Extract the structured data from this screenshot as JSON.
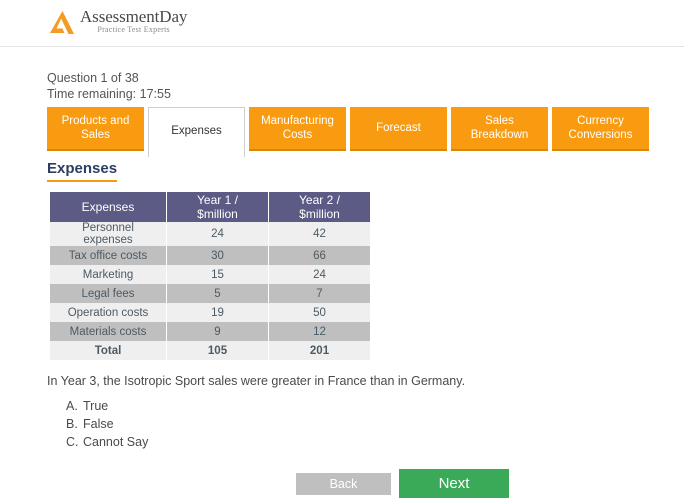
{
  "brand": {
    "logo_icon": "assessmentday-triangle-logo",
    "name": "AssessmentDay",
    "tagline": "Practice Test Experts",
    "accent_orange": "#F99B10",
    "heading_navy": "#2C3E63",
    "table_header_purple": "#5B5B85",
    "next_green": "#3BAA58",
    "back_gray": "#BFBFBF"
  },
  "meta": {
    "question_counter": "Question 1 of 38",
    "time_remaining": "Time remaining: 17:55"
  },
  "tabs": [
    {
      "label": "Products and Sales",
      "active": false
    },
    {
      "label": "Expenses",
      "active": true
    },
    {
      "label": "Manufacturing Costs",
      "active": false
    },
    {
      "label": "Forecast",
      "active": false
    },
    {
      "label": "Sales Breakdown",
      "active": false
    },
    {
      "label": "Currency Conversions",
      "active": false
    }
  ],
  "section": {
    "heading": "Expenses"
  },
  "chart_data": {
    "type": "table",
    "title": "Expenses",
    "columns": [
      "Expenses",
      "Year 1 / $million",
      "Year 2 / $million"
    ],
    "categories": [
      "Personnel expenses",
      "Tax office costs",
      "Marketing",
      "Legal fees",
      "Operation costs",
      "Materials costs",
      "Total"
    ],
    "series": [
      {
        "name": "Year 1 / $million",
        "values": [
          24,
          30,
          15,
          5,
          19,
          9,
          105
        ]
      },
      {
        "name": "Year 2 / $million",
        "values": [
          42,
          66,
          24,
          7,
          50,
          12,
          201
        ]
      }
    ],
    "rows": [
      {
        "label": "Personnel expenses",
        "year1": "24",
        "year2": "42",
        "style": "light"
      },
      {
        "label": "Tax office costs",
        "year1": "30",
        "year2": "66",
        "style": "dark"
      },
      {
        "label": "Marketing",
        "year1": "15",
        "year2": "24",
        "style": "light"
      },
      {
        "label": "Legal fees",
        "year1": "5",
        "year2": "7",
        "style": "dark"
      },
      {
        "label": "Operation costs",
        "year1": "19",
        "year2": "50",
        "style": "light"
      },
      {
        "label": "Materials costs",
        "year1": "9",
        "year2": "12",
        "style": "dark"
      },
      {
        "label": "Total",
        "year1": "105",
        "year2": "201",
        "style": "total"
      }
    ],
    "xlabel": "",
    "ylabel": "$million",
    "grid": false,
    "legend": "none"
  },
  "question": {
    "stem": "In Year 3, the Isotropic Sport sales were greater in France than in Germany.",
    "answers": [
      {
        "letter": "A.",
        "text": "True"
      },
      {
        "letter": "B.",
        "text": "False"
      },
      {
        "letter": "C.",
        "text": "Cannot Say"
      }
    ]
  },
  "footer": {
    "back_label": "Back",
    "next_label": "Next"
  }
}
